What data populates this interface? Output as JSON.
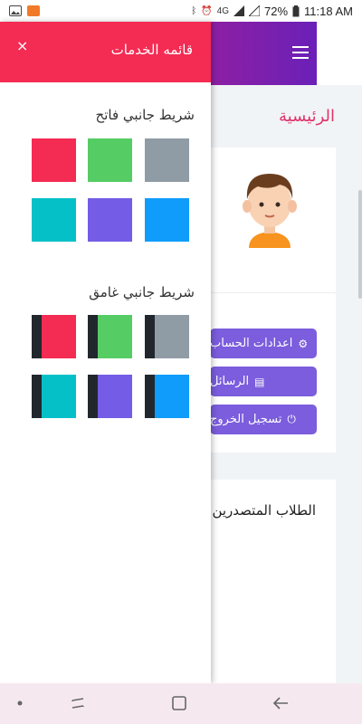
{
  "status_bar": {
    "battery": "72%",
    "time": "11:18 AM",
    "network": "4G",
    "app_icon_colors": [
      "#444444",
      "#f17a28"
    ]
  },
  "drawer": {
    "title": "قائمه الخدمات",
    "close_icon": "×",
    "header_color": "#f42b53",
    "light_sidebar": {
      "title": "شريط جانبي فاتح",
      "swatches": [
        "#f42b53",
        "#56cc64",
        "#8f9ca6",
        "#05c1c7",
        "#745ce6",
        "#0f9cfb"
      ]
    },
    "dark_sidebar": {
      "title": "شريط جانبي غامق",
      "swatches": [
        "#f42b53",
        "#56cc64",
        "#8f9ca6",
        "#05c1c7",
        "#745ce6",
        "#0f9cfb"
      ],
      "strip_color": "#22272e"
    }
  },
  "background_page": {
    "page_title": "الرئيسية",
    "buttons": {
      "settings": "اعدادات الحساب",
      "messages": "الرسائل",
      "logout": "تسجيل الخروج"
    },
    "top_students": "الطلاب المتصدرين",
    "button_color": "#7b5ddd",
    "accent_color": "#e0336a"
  },
  "nav_bar": {
    "icons": [
      "dot-icon",
      "recent-apps-icon",
      "home-icon",
      "back-icon"
    ]
  }
}
